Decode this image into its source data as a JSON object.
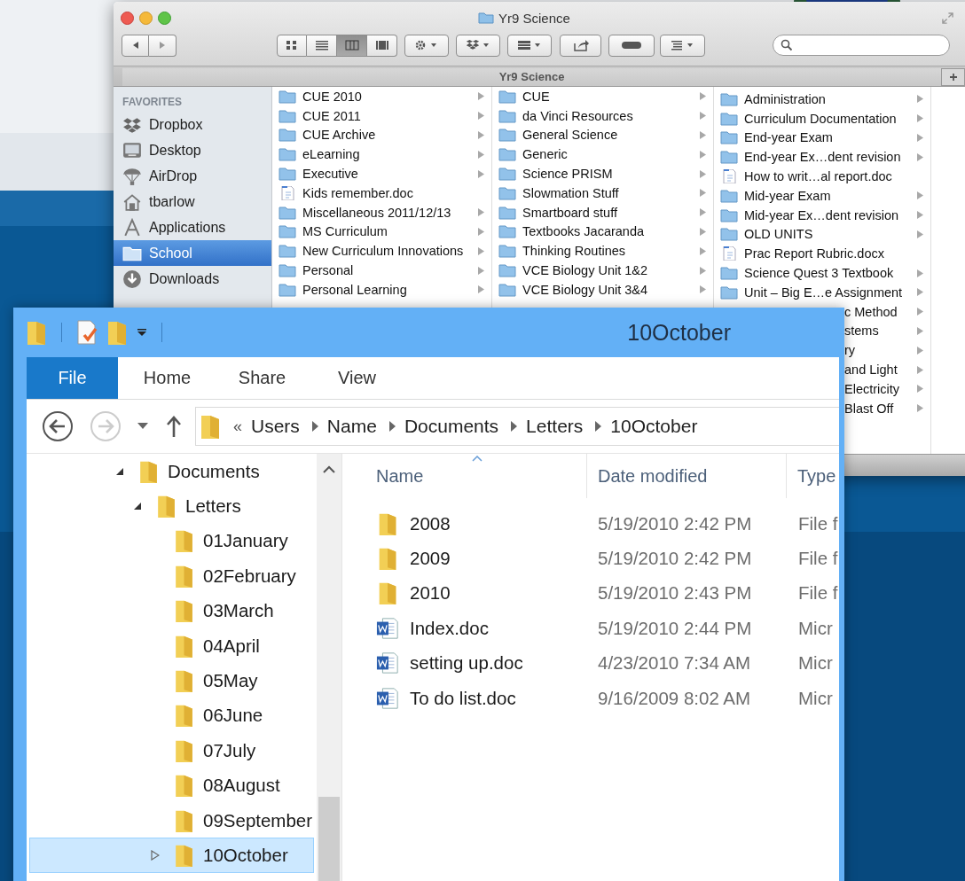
{
  "finder": {
    "title": "Yr9 Science",
    "view_modes": [
      {
        "kind": "icon",
        "selected": false
      },
      {
        "kind": "list",
        "selected": false
      },
      {
        "kind": "column",
        "selected": true
      },
      {
        "kind": "coverflow",
        "selected": false
      }
    ],
    "tab": "Yr9 Science",
    "sidebar": {
      "heading": "FAVORITES",
      "items": [
        {
          "label": "Dropbox",
          "kind": "dropbox",
          "selected": false
        },
        {
          "label": "Desktop",
          "kind": "desktop",
          "selected": false
        },
        {
          "label": "AirDrop",
          "kind": "airdrop",
          "selected": false
        },
        {
          "label": "tbarlow",
          "kind": "home",
          "selected": false
        },
        {
          "label": "Applications",
          "kind": "applications",
          "selected": false
        },
        {
          "label": "School",
          "kind": "folder",
          "selected": true
        },
        {
          "label": "Downloads",
          "kind": "downloads",
          "selected": false
        }
      ]
    },
    "columns": [
      [
        {
          "name": "CUE 2010",
          "kind": "folder"
        },
        {
          "name": "CUE 2011",
          "kind": "folder"
        },
        {
          "name": "CUE Archive",
          "kind": "folder"
        },
        {
          "name": "eLearning",
          "kind": "folder"
        },
        {
          "name": "Executive",
          "kind": "folder"
        },
        {
          "name": "Kids remember.doc",
          "kind": "doc"
        },
        {
          "name": "Miscellaneous 2011/12/13",
          "kind": "folder"
        },
        {
          "name": "MS Curriculum",
          "kind": "folder"
        },
        {
          "name": "New Curriculum Innovations",
          "kind": "folder"
        },
        {
          "name": "Personal",
          "kind": "folder"
        },
        {
          "name": "Personal Learning",
          "kind": "folder"
        }
      ],
      [
        {
          "name": "CUE",
          "kind": "folder"
        },
        {
          "name": "da Vinci Resources",
          "kind": "folder"
        },
        {
          "name": "General Science",
          "kind": "folder"
        },
        {
          "name": "Generic",
          "kind": "folder"
        },
        {
          "name": "Science PRISM",
          "kind": "folder"
        },
        {
          "name": "Slowmation Stuff",
          "kind": "folder"
        },
        {
          "name": "Smartboard stuff",
          "kind": "folder"
        },
        {
          "name": "Textbooks Jacaranda",
          "kind": "folder"
        },
        {
          "name": "Thinking Routines",
          "kind": "folder"
        },
        {
          "name": "VCE Biology Unit 1&2",
          "kind": "folder"
        },
        {
          "name": "VCE Biology Unit 3&4",
          "kind": "folder"
        }
      ],
      [
        {
          "name": "Administration",
          "kind": "folder"
        },
        {
          "name": "Curriculum Documentation",
          "kind": "folder"
        },
        {
          "name": "End-year Exam",
          "kind": "folder"
        },
        {
          "name": "End-year Ex…dent revision",
          "kind": "folder"
        },
        {
          "name": "How to writ…al report.doc",
          "kind": "doc"
        },
        {
          "name": "Mid-year Exam",
          "kind": "folder"
        },
        {
          "name": "Mid-year Ex…dent revision",
          "kind": "folder"
        },
        {
          "name": "OLD UNITS",
          "kind": "folder"
        },
        {
          "name": "Prac Report Rubric.docx",
          "kind": "doc"
        },
        {
          "name": "Science Quest 3 Textbook",
          "kind": "folder"
        },
        {
          "name": "Unit – Big E…e Assignment",
          "kind": "folder"
        },
        {
          "name": "c Method",
          "kind": "folder_cut"
        },
        {
          "name": "stems",
          "kind": "folder_cut"
        },
        {
          "name": "ry",
          "kind": "folder_cut"
        },
        {
          "name": "and Light",
          "kind": "folder_cut"
        },
        {
          "name": "Electricity",
          "kind": "folder_cut"
        },
        {
          "name": "Blast Off",
          "kind": "folder_cut"
        }
      ]
    ]
  },
  "explorer": {
    "title": "10October",
    "ribbon_tabs": [
      {
        "label": "File",
        "selected": true
      },
      {
        "label": "Home",
        "selected": false
      },
      {
        "label": "Share",
        "selected": false
      },
      {
        "label": "View",
        "selected": false
      }
    ],
    "address": {
      "overflow": "«",
      "segments": [
        "Users",
        "Name",
        "Documents",
        "Letters",
        "10October"
      ]
    },
    "tree": [
      {
        "label": "Documents",
        "expanded": true,
        "selected": false,
        "children": [
          {
            "label": "Letters",
            "expanded": true,
            "selected": false,
            "children": [
              {
                "label": "01January",
                "selected": false
              },
              {
                "label": "02February",
                "selected": false
              },
              {
                "label": "03March",
                "selected": false
              },
              {
                "label": "04April",
                "selected": false
              },
              {
                "label": "05May",
                "selected": false
              },
              {
                "label": "06June",
                "selected": false
              },
              {
                "label": "07July",
                "selected": false
              },
              {
                "label": "08August",
                "selected": false
              },
              {
                "label": "09September",
                "selected": false
              },
              {
                "label": "10October",
                "selected": true,
                "expanded": false
              }
            ]
          }
        ]
      }
    ],
    "columns": [
      "Name",
      "Date modified",
      "Type"
    ],
    "files": [
      {
        "name": "2008",
        "kind": "folder",
        "date": "5/19/2010 2:42 PM",
        "type": "File f"
      },
      {
        "name": "2009",
        "kind": "folder",
        "date": "5/19/2010 2:42 PM",
        "type": "File f"
      },
      {
        "name": "2010",
        "kind": "folder",
        "date": "5/19/2010 2:43 PM",
        "type": "File f"
      },
      {
        "name": "Index.doc",
        "kind": "doc",
        "date": "5/19/2010 2:44 PM",
        "type": "Micr"
      },
      {
        "name": "setting up.doc",
        "kind": "doc",
        "date": "4/23/2010 7:34 AM",
        "type": "Micr"
      },
      {
        "name": "To do list.doc",
        "kind": "doc",
        "date": "9/16/2009 8:02 AM",
        "type": "Micr"
      }
    ]
  }
}
